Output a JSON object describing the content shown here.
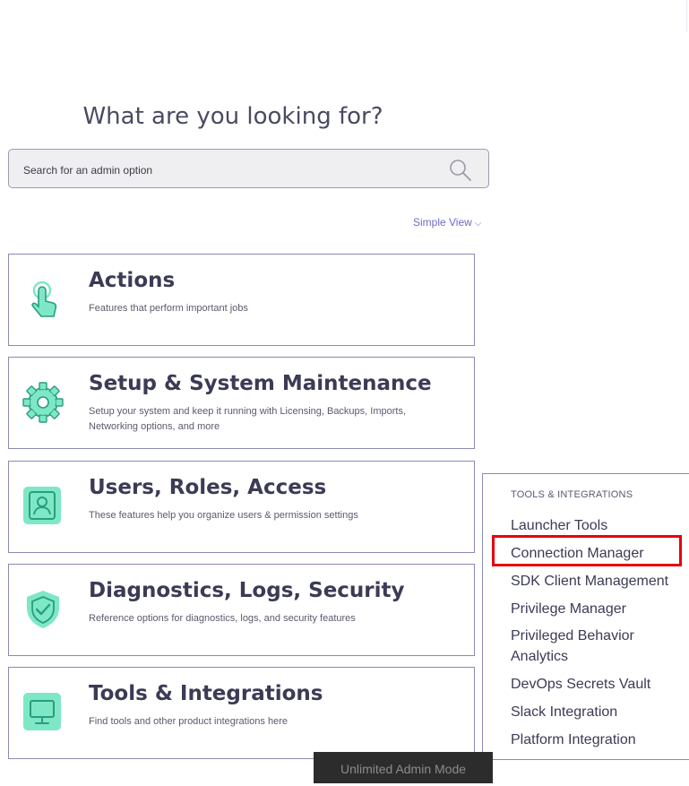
{
  "headline": "What are you looking for?",
  "search": {
    "placeholder": "Search for an admin option",
    "icon": "search-icon"
  },
  "view_toggle": {
    "label": "Simple View",
    "icon": "chevron-down-icon"
  },
  "categories": [
    {
      "title": "Actions",
      "description": "Features that perform important jobs",
      "icon": "hand-pointer-icon"
    },
    {
      "title": "Setup & System Maintenance",
      "description": "Setup your system and keep it running with Licensing, Backups, Imports, Networking options, and more",
      "icon": "gear-icon"
    },
    {
      "title": "Users, Roles, Access",
      "description": "These features help you organize users & permission settings",
      "icon": "user-icon"
    },
    {
      "title": "Diagnostics, Logs, Security",
      "description": "Reference options for diagnostics, logs, and security features",
      "icon": "shield-check-icon"
    },
    {
      "title": "Tools & Integrations",
      "description": "Find tools and other product integrations here",
      "icon": "monitor-icon"
    }
  ],
  "flyout": {
    "heading": "TOOLS & INTEGRATIONS",
    "items": [
      "Launcher Tools",
      "Connection Manager",
      "SDK Client Management",
      "Privilege Manager",
      "Privileged Behavior Analytics",
      "DevOps Secrets Vault",
      "Slack Integration",
      "Platform Integration"
    ],
    "highlighted_item": "Connection Manager"
  },
  "colors": {
    "accent": "#6e6ac8",
    "icon_fill": "#7ee8c6",
    "icon_stroke": "#2a9d7e",
    "highlight": "#e8000b"
  },
  "mode_badge": "Unlimited Admin Mode"
}
